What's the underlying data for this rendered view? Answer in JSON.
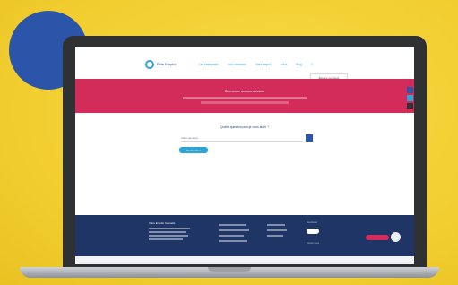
{
  "scene": {
    "background_color": "#f1cc2e",
    "accent_circle_color": "#2b55a8",
    "laptop_color": "#2f3133"
  },
  "site": {
    "logo_text": "Pôle Emploi",
    "nav": [
      "Les entreprises",
      "Vous cherchez",
      "Votre emploi",
      "Actus",
      "Blog",
      "?"
    ],
    "header_cta": "Espace recruteur",
    "hero": {
      "title": "Bienvenue sur nos services",
      "color": "#d42c5a"
    },
    "side_icons": [
      "facebook-icon",
      "twitter-icon",
      "linkedin-icon"
    ],
    "question": "Quelle question puis-je vous aider ?",
    "search": {
      "placeholder": "Votre question"
    },
    "action_button": "Rechercher",
    "footer": {
      "title": "Votre Emploi Conseils",
      "color": "#1f3566",
      "newsletter_label": "Newsletter",
      "follow_label": "Suivez nous"
    }
  }
}
